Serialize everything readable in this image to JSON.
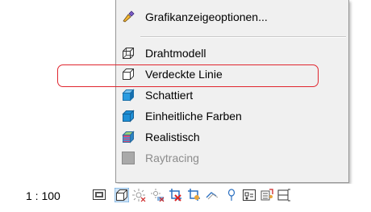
{
  "menu": {
    "items": [
      {
        "label": "Grafikanzeigeoptionen...",
        "icon": "brush-settings-icon",
        "enabled": true
      },
      {
        "label": "Drahtmodell",
        "icon": "wireframe-cube-icon",
        "enabled": true
      },
      {
        "label": "Verdeckte Linie",
        "icon": "hidden-line-cube-icon",
        "enabled": true,
        "highlighted": true
      },
      {
        "label": "Schattiert",
        "icon": "shaded-cube-icon",
        "enabled": true
      },
      {
        "label": "Einheitliche Farben",
        "icon": "consistent-colors-cube-icon",
        "enabled": true
      },
      {
        "label": "Realistisch",
        "icon": "realistic-cube-icon",
        "enabled": true
      },
      {
        "label": "Raytracing",
        "icon": "raytracing-icon",
        "enabled": false
      }
    ]
  },
  "statusbar": {
    "scale": "1 : 100",
    "icons": [
      "detail-level-icon",
      "visual-style-icon",
      "sun-path-icon",
      "shadows-icon",
      "crop-view-icon",
      "show-crop-region-icon",
      "unlock-3d-view-icon",
      "temporary-hide-icon",
      "reveal-hidden-icon",
      "analytical-model-icon",
      "highlight-displacement-icon"
    ]
  },
  "colors": {
    "highlight_border": "#e0262f",
    "menu_background": "#f0f0f0",
    "cube_blue": "#1e8fd6",
    "disabled_text": "#8c8c8c"
  }
}
